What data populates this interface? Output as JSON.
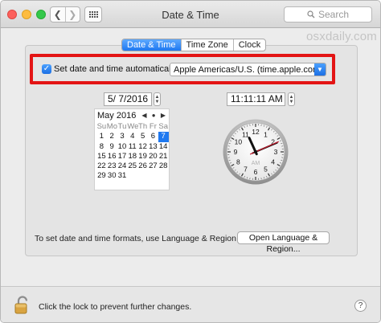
{
  "window": {
    "title": "Date & Time"
  },
  "toolbar": {
    "back_glyph": "❮",
    "forward_glyph": "❯",
    "search_placeholder": "Search"
  },
  "watermark": "osxdaily.com",
  "tabs": [
    {
      "label": "Date & Time",
      "selected": true
    },
    {
      "label": "Time Zone",
      "selected": false
    },
    {
      "label": "Clock",
      "selected": false
    }
  ],
  "auto": {
    "checked": true,
    "label": "Set date and time automatically:",
    "server": "Apple Americas/U.S. (time.apple.com.)"
  },
  "date": {
    "field": "5/  7/2016",
    "time_field": "11:11:11 AM"
  },
  "calendar": {
    "month_label": "May 2016",
    "nav": "◀ ● ▶",
    "weekdays": [
      "Su",
      "Mo",
      "Tu",
      "We",
      "Th",
      "Fr",
      "Sa"
    ],
    "days": [
      "1",
      "2",
      "3",
      "4",
      "5",
      "6",
      "7",
      "8",
      "9",
      "10",
      "11",
      "12",
      "13",
      "14",
      "15",
      "16",
      "17",
      "18",
      "19",
      "20",
      "21",
      "22",
      "23",
      "24",
      "25",
      "26",
      "27",
      "28",
      "29",
      "30",
      "31"
    ],
    "leading_blank": 0,
    "selected_day": "7"
  },
  "clock": {
    "numerals": [
      "12",
      "1",
      "2",
      "3",
      "4",
      "5",
      "6",
      "7",
      "8",
      "9",
      "10",
      "11"
    ],
    "ampm": "AM",
    "hour": 11,
    "minute": 11,
    "second": 11
  },
  "footer": {
    "note": "To set date and time formats, use Language & Region preferences.",
    "button": "Open Language & Region..."
  },
  "bottom": {
    "lock_text": "Click the lock to prevent further changes.",
    "help": "?"
  },
  "colors": {
    "accent": "#1e78f0",
    "highlight_box": "#e31414",
    "second_hand": "#c0182a"
  }
}
